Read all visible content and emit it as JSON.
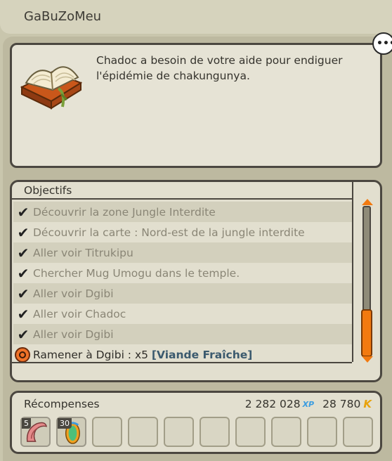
{
  "window": {
    "title": "GaBuZoMeu"
  },
  "quest": {
    "description": "Chadoc a besoin de votre aide pour endiguer l'épidémie de chakungunya."
  },
  "objectives": {
    "header": "Objectifs",
    "items": [
      {
        "text": "Découvrir la zone Jungle Interdite",
        "done": true
      },
      {
        "text": "Découvrir la carte : Nord-est de la jungle interdite",
        "done": true
      },
      {
        "text": "Aller voir Titrukipu",
        "done": true
      },
      {
        "text": "Chercher Mug Umogu dans le temple.",
        "done": true
      },
      {
        "text": "Aller voir Dgibi",
        "done": true
      },
      {
        "text": "Aller voir Chadoc",
        "done": true
      },
      {
        "text": "Aller voir Dgibi",
        "done": true
      }
    ],
    "active": {
      "prefix": "Ramener à Dgibi : x5 ",
      "item": "[Viande Fraîche]"
    }
  },
  "rewards": {
    "header": "Récompenses",
    "xp": "2 282 028",
    "xp_label": "XP",
    "kamas": "28 780",
    "kamas_label": "K",
    "items": [
      {
        "qty": "5",
        "icon": "claw-item-icon"
      },
      {
        "qty": "30",
        "icon": "potion-item-icon"
      }
    ]
  },
  "colors": {
    "accent": "#f27a10",
    "background": "#c9c6ad",
    "panel": "#e2dfcf"
  }
}
